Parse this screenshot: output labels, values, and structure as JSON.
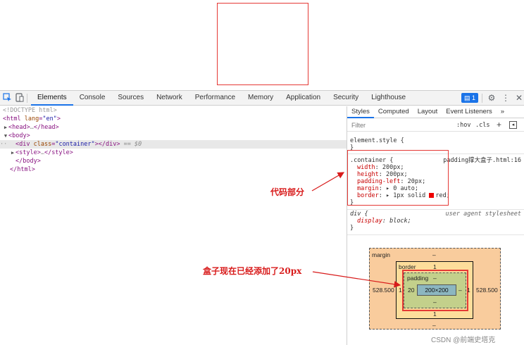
{
  "toolbar": {
    "tabs": [
      "Elements",
      "Console",
      "Sources",
      "Network",
      "Performance",
      "Memory",
      "Application",
      "Security",
      "Lighthouse"
    ],
    "active_tab": "Elements",
    "badge_count": "1",
    "accent_color": "#1a73e8"
  },
  "elements": {
    "doctype": "<!DOCTYPE html>",
    "html_open_tag": "<html",
    "html_lang_attr": "lang",
    "html_lang_val": "\"en\"",
    "head_tag": "<head>",
    "head_close": "</head>",
    "body_tag": "<body>",
    "div_open": "<div",
    "div_class_attr": "class",
    "div_class_val": "\"container\"",
    "div_close": "></div>",
    "selected_marker": "== $0",
    "style_tag": "<style>",
    "style_close": "</style>",
    "body_close": "</body>",
    "html_close": "</html>",
    "ellipsis": "…",
    "row_dots": "··"
  },
  "styles": {
    "subtabs": [
      "Styles",
      "Computed",
      "Layout",
      "Event Listeners",
      "»"
    ],
    "filter_placeholder": "Filter",
    "hov": ":hov",
    "cls": ".cls",
    "element_style": "element.style {",
    "close_brace": "}",
    "rule1": {
      "selector": ".container {",
      "source": "padding撑大盒子.html:16",
      "decls": [
        {
          "prop": "width",
          "value": "200px;"
        },
        {
          "prop": "height",
          "value": "200px;"
        },
        {
          "prop": "padding-left",
          "value": "20px;"
        },
        {
          "prop": "margin",
          "value": "▸ 0 auto;"
        },
        {
          "prop": "border",
          "value": "▸ 1px solid ",
          "value2": "red;"
        }
      ]
    },
    "rule2": {
      "selector": "div {",
      "source": "user agent stylesheet",
      "decls": [
        {
          "prop": "display",
          "value": "block;"
        }
      ]
    }
  },
  "box_model": {
    "margin_label": "margin",
    "margin_top": "–",
    "margin_bottom": "–",
    "margin_left": "528.500",
    "margin_right": "528.500",
    "border_label": "border",
    "border_top": "1",
    "border_bottom": "1",
    "border_left": "1",
    "border_right": "1",
    "padding_label": "padding",
    "padding_top": "–",
    "padding_bottom": "–",
    "padding_left": "20",
    "padding_right": "–",
    "content": "200×200"
  },
  "annotations": {
    "code_part": "代码部分",
    "box_added": "盒子现在已经添加了20px",
    "color": "#d81b1b"
  },
  "watermark": "CSDN @前端史塔克"
}
